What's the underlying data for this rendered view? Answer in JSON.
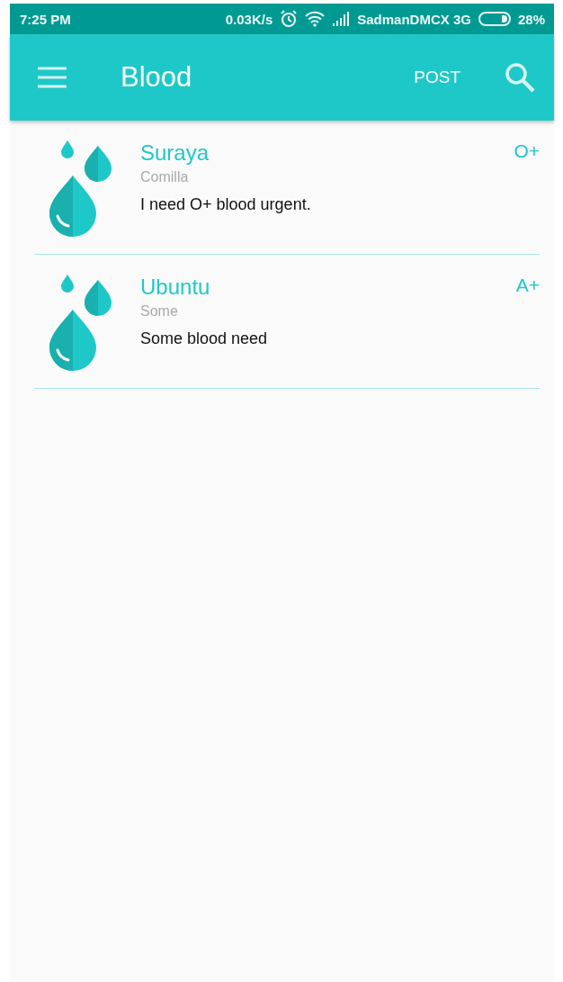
{
  "status_bar": {
    "time": "7:25 PM",
    "speed": "0.03K/s",
    "carrier": "SadmanDMCX 3G",
    "battery": "28%"
  },
  "app_bar": {
    "title": "Blood",
    "action": "POST"
  },
  "posts": [
    {
      "name": "Suraya",
      "location": "Comilla",
      "message": "I need O+ blood urgent.",
      "blood_group": "O+"
    },
    {
      "name": "Ubuntu",
      "location": "Some",
      "message": "Some blood need",
      "blood_group": "A+"
    }
  ]
}
